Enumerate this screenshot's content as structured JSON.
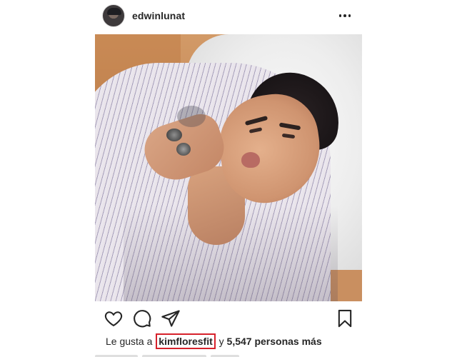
{
  "post": {
    "username": "edwinlunat",
    "avatar_icon": "profile-avatar",
    "more_icon": "more-horizontal-icon",
    "photo_alt": "",
    "actions": {
      "like_icon": "heart-icon",
      "comment_icon": "comment-icon",
      "share_icon": "send-icon",
      "save_icon": "bookmark-icon"
    },
    "likes": {
      "prefix": "Le gusta a",
      "user": "kimfloresfit",
      "connector": "y",
      "count": "5,547 personas más"
    }
  },
  "colors": {
    "highlight_box": "#d6212b",
    "text": "#262626"
  }
}
